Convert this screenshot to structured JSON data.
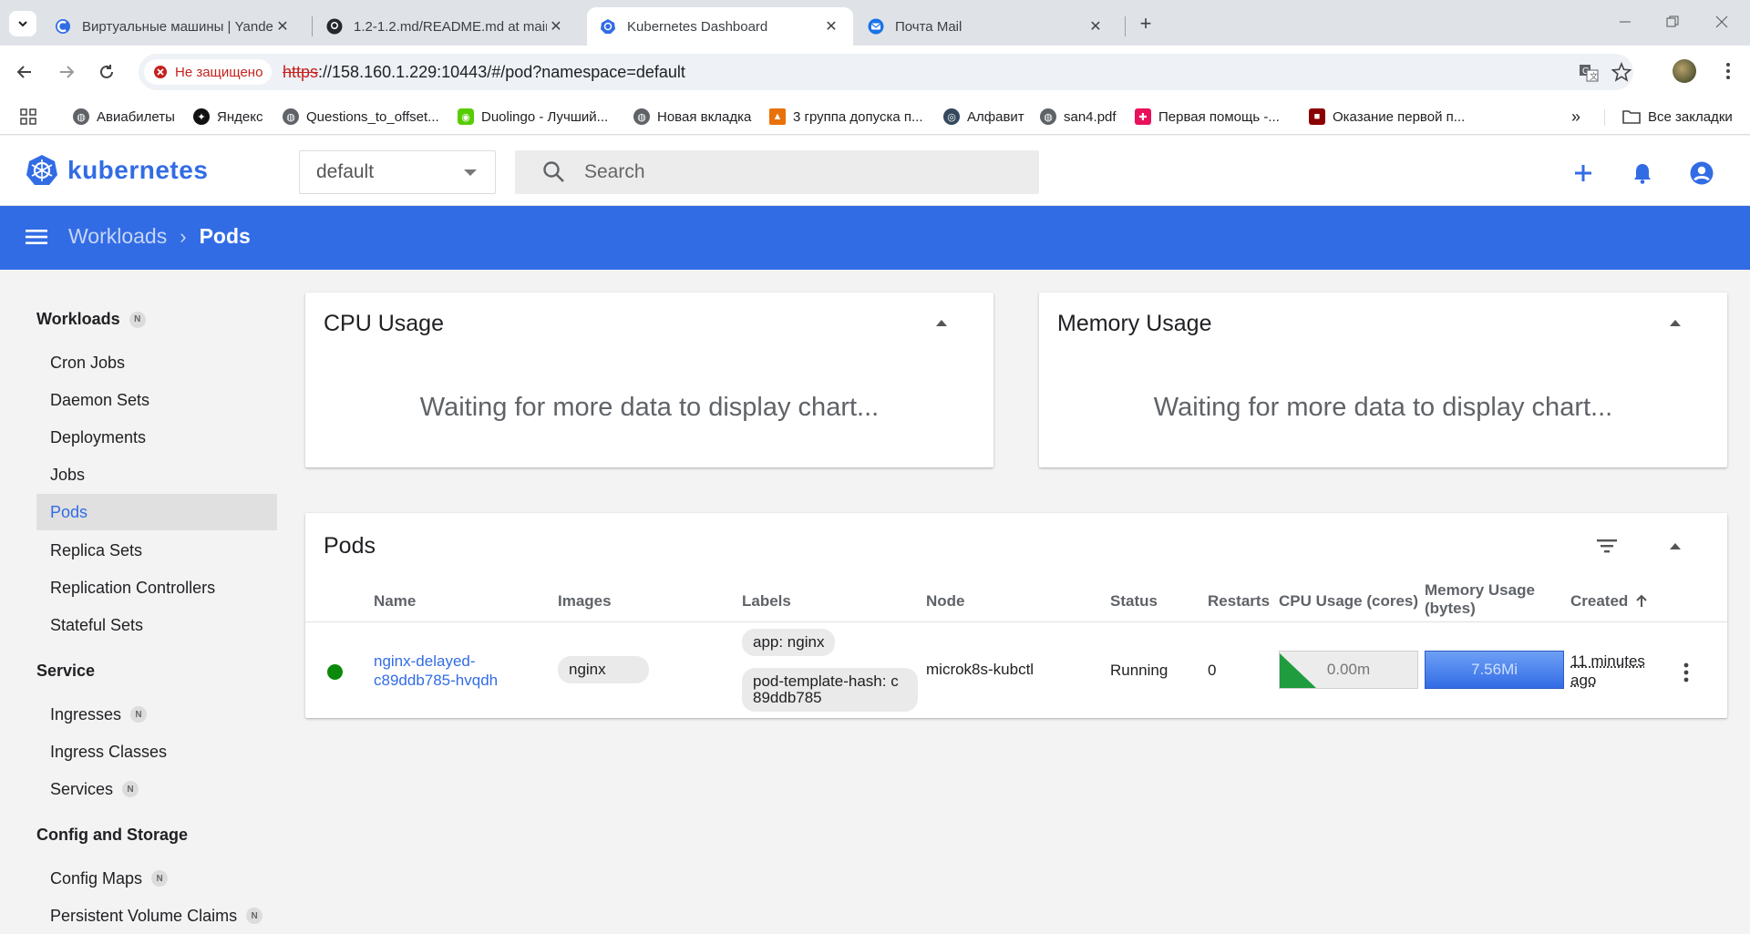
{
  "browser": {
    "tabs": [
      {
        "title": "Виртуальные машины | Yandex",
        "active": false
      },
      {
        "title": "1.2-1.2.md/README.md at main",
        "active": false
      },
      {
        "title": "Kubernetes Dashboard",
        "active": true
      },
      {
        "title": "Почта Mail",
        "active": false
      }
    ],
    "security_label": "Не защищено",
    "url_scheme": "https",
    "url_rest": "://158.160.1.229:10443/#/pod?namespace=default",
    "bookmarks": [
      "Авиабилеты",
      "Яндекс",
      "Questions_to_offset...",
      "Duolingo - Лучший...",
      "Новая вкладка",
      "3 группа допуска п...",
      "Алфавит",
      "san4.pdf",
      "Первая помощь -...",
      "Оказание первой п..."
    ],
    "all_bookmarks": "Все закладки"
  },
  "app": {
    "brand": "kubernetes",
    "namespace": "default",
    "search_placeholder": "Search",
    "breadcrumb": {
      "parent": "Workloads",
      "current": "Pods"
    }
  },
  "sidebar": {
    "workloads_title": "Workloads",
    "badge": "N",
    "workloads": [
      "Cron Jobs",
      "Daemon Sets",
      "Deployments",
      "Jobs",
      "Pods",
      "Replica Sets",
      "Replication Controllers",
      "Stateful Sets"
    ],
    "service_title": "Service",
    "service": [
      "Ingresses",
      "Ingress Classes",
      "Services"
    ],
    "config_title": "Config and Storage",
    "config": [
      "Config Maps",
      "Persistent Volume Claims"
    ]
  },
  "cpu_card": {
    "title": "CPU Usage",
    "message": "Waiting for more data to display chart..."
  },
  "mem_card": {
    "title": "Memory Usage",
    "message": "Waiting for more data to display chart..."
  },
  "pods": {
    "title": "Pods",
    "columns": {
      "name": "Name",
      "images": "Images",
      "labels": "Labels",
      "node": "Node",
      "status": "Status",
      "restarts": "Restarts",
      "cpu": "CPU Usage (cores)",
      "memory_line1": "Memory Usage",
      "memory_line2": "(bytes)",
      "created": "Created"
    },
    "row": {
      "name_line1": "nginx-delayed-",
      "name_line2": "c89ddb785-hvqdh",
      "image": "nginx",
      "label1": "app: nginx",
      "label2_line1": "pod-template-hash: c",
      "label2_line2": "89ddb785",
      "node": "microk8s-kubctl",
      "status": "Running",
      "restarts": "0",
      "cpu": "0.00m",
      "memory": "7.56Mi",
      "created_line1": "11 minutes",
      "created_line2": "ago",
      "status_color": "#0a8a0a"
    }
  },
  "colors": {
    "primary": "#326ce5",
    "danger": "#c5221f"
  }
}
